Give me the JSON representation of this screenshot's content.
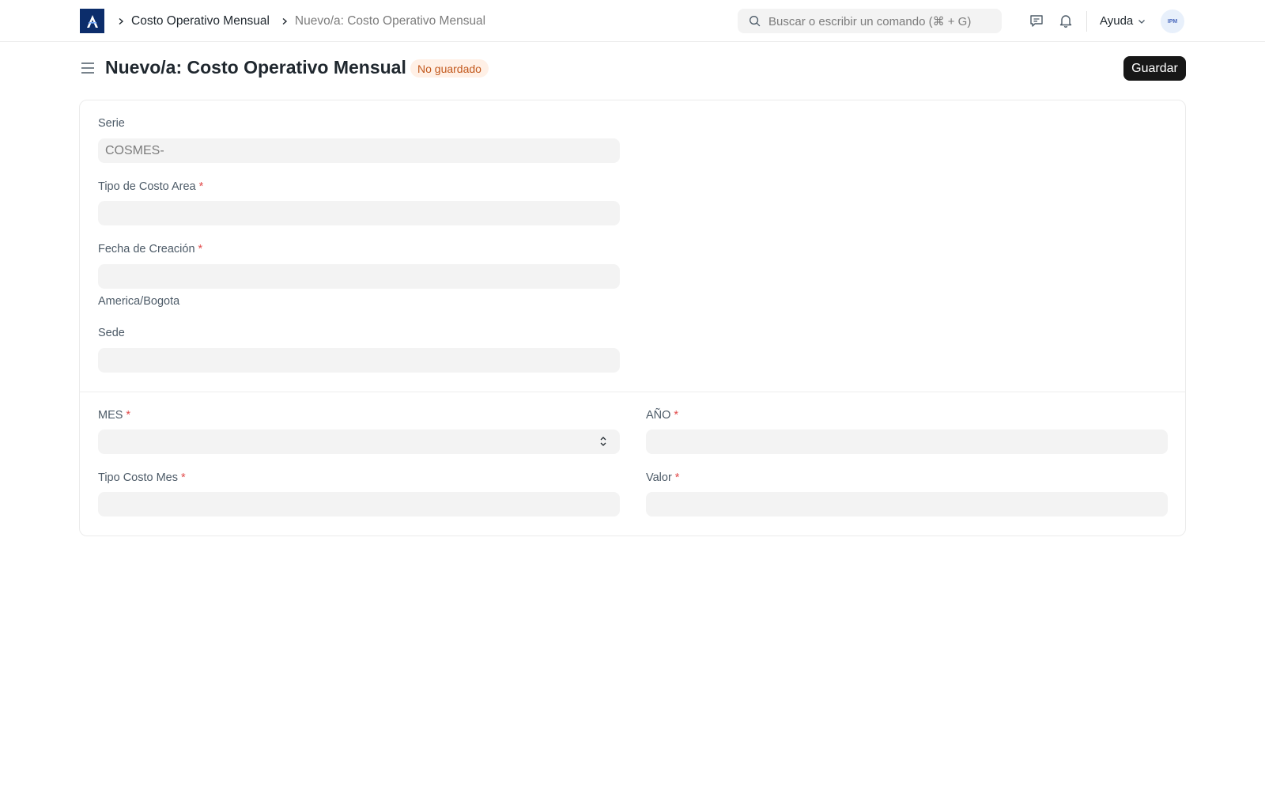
{
  "navbar": {
    "logo_icon": "app-logo-icon",
    "breadcrumbs": [
      {
        "label": "Costo Operativo Mensual"
      },
      {
        "label": "Nuevo/a: Costo Operativo Mensual"
      }
    ],
    "search_placeholder": "Buscar o escribir un comando (⌘ + G)",
    "help_label": "Ayuda",
    "avatar_initials": "IPM"
  },
  "page": {
    "title": "Nuevo/a: Costo Operativo Mensual",
    "status_badge": "No guardado",
    "badge_color": "#c2581c",
    "save_label": "Guardar",
    "save_color": "#171717"
  },
  "form": {
    "serie": {
      "label": "Serie",
      "value": "COSMES-"
    },
    "tipo_costo_area": {
      "label": "Tipo de Costo Area",
      "required": "*",
      "value": ""
    },
    "fecha_creacion": {
      "label": "Fecha de Creación",
      "required": "*",
      "value": "",
      "timezone": "America/Bogota"
    },
    "sede": {
      "label": "Sede",
      "value": ""
    },
    "mes": {
      "label": "MES",
      "required": "*",
      "value": ""
    },
    "anio": {
      "label": "AÑO",
      "required": "*",
      "value": ""
    },
    "tipo_costo_mes": {
      "label": "Tipo Costo Mes",
      "required": "*",
      "value": ""
    },
    "valor": {
      "label": "Valor",
      "required": "*",
      "value": ""
    }
  }
}
